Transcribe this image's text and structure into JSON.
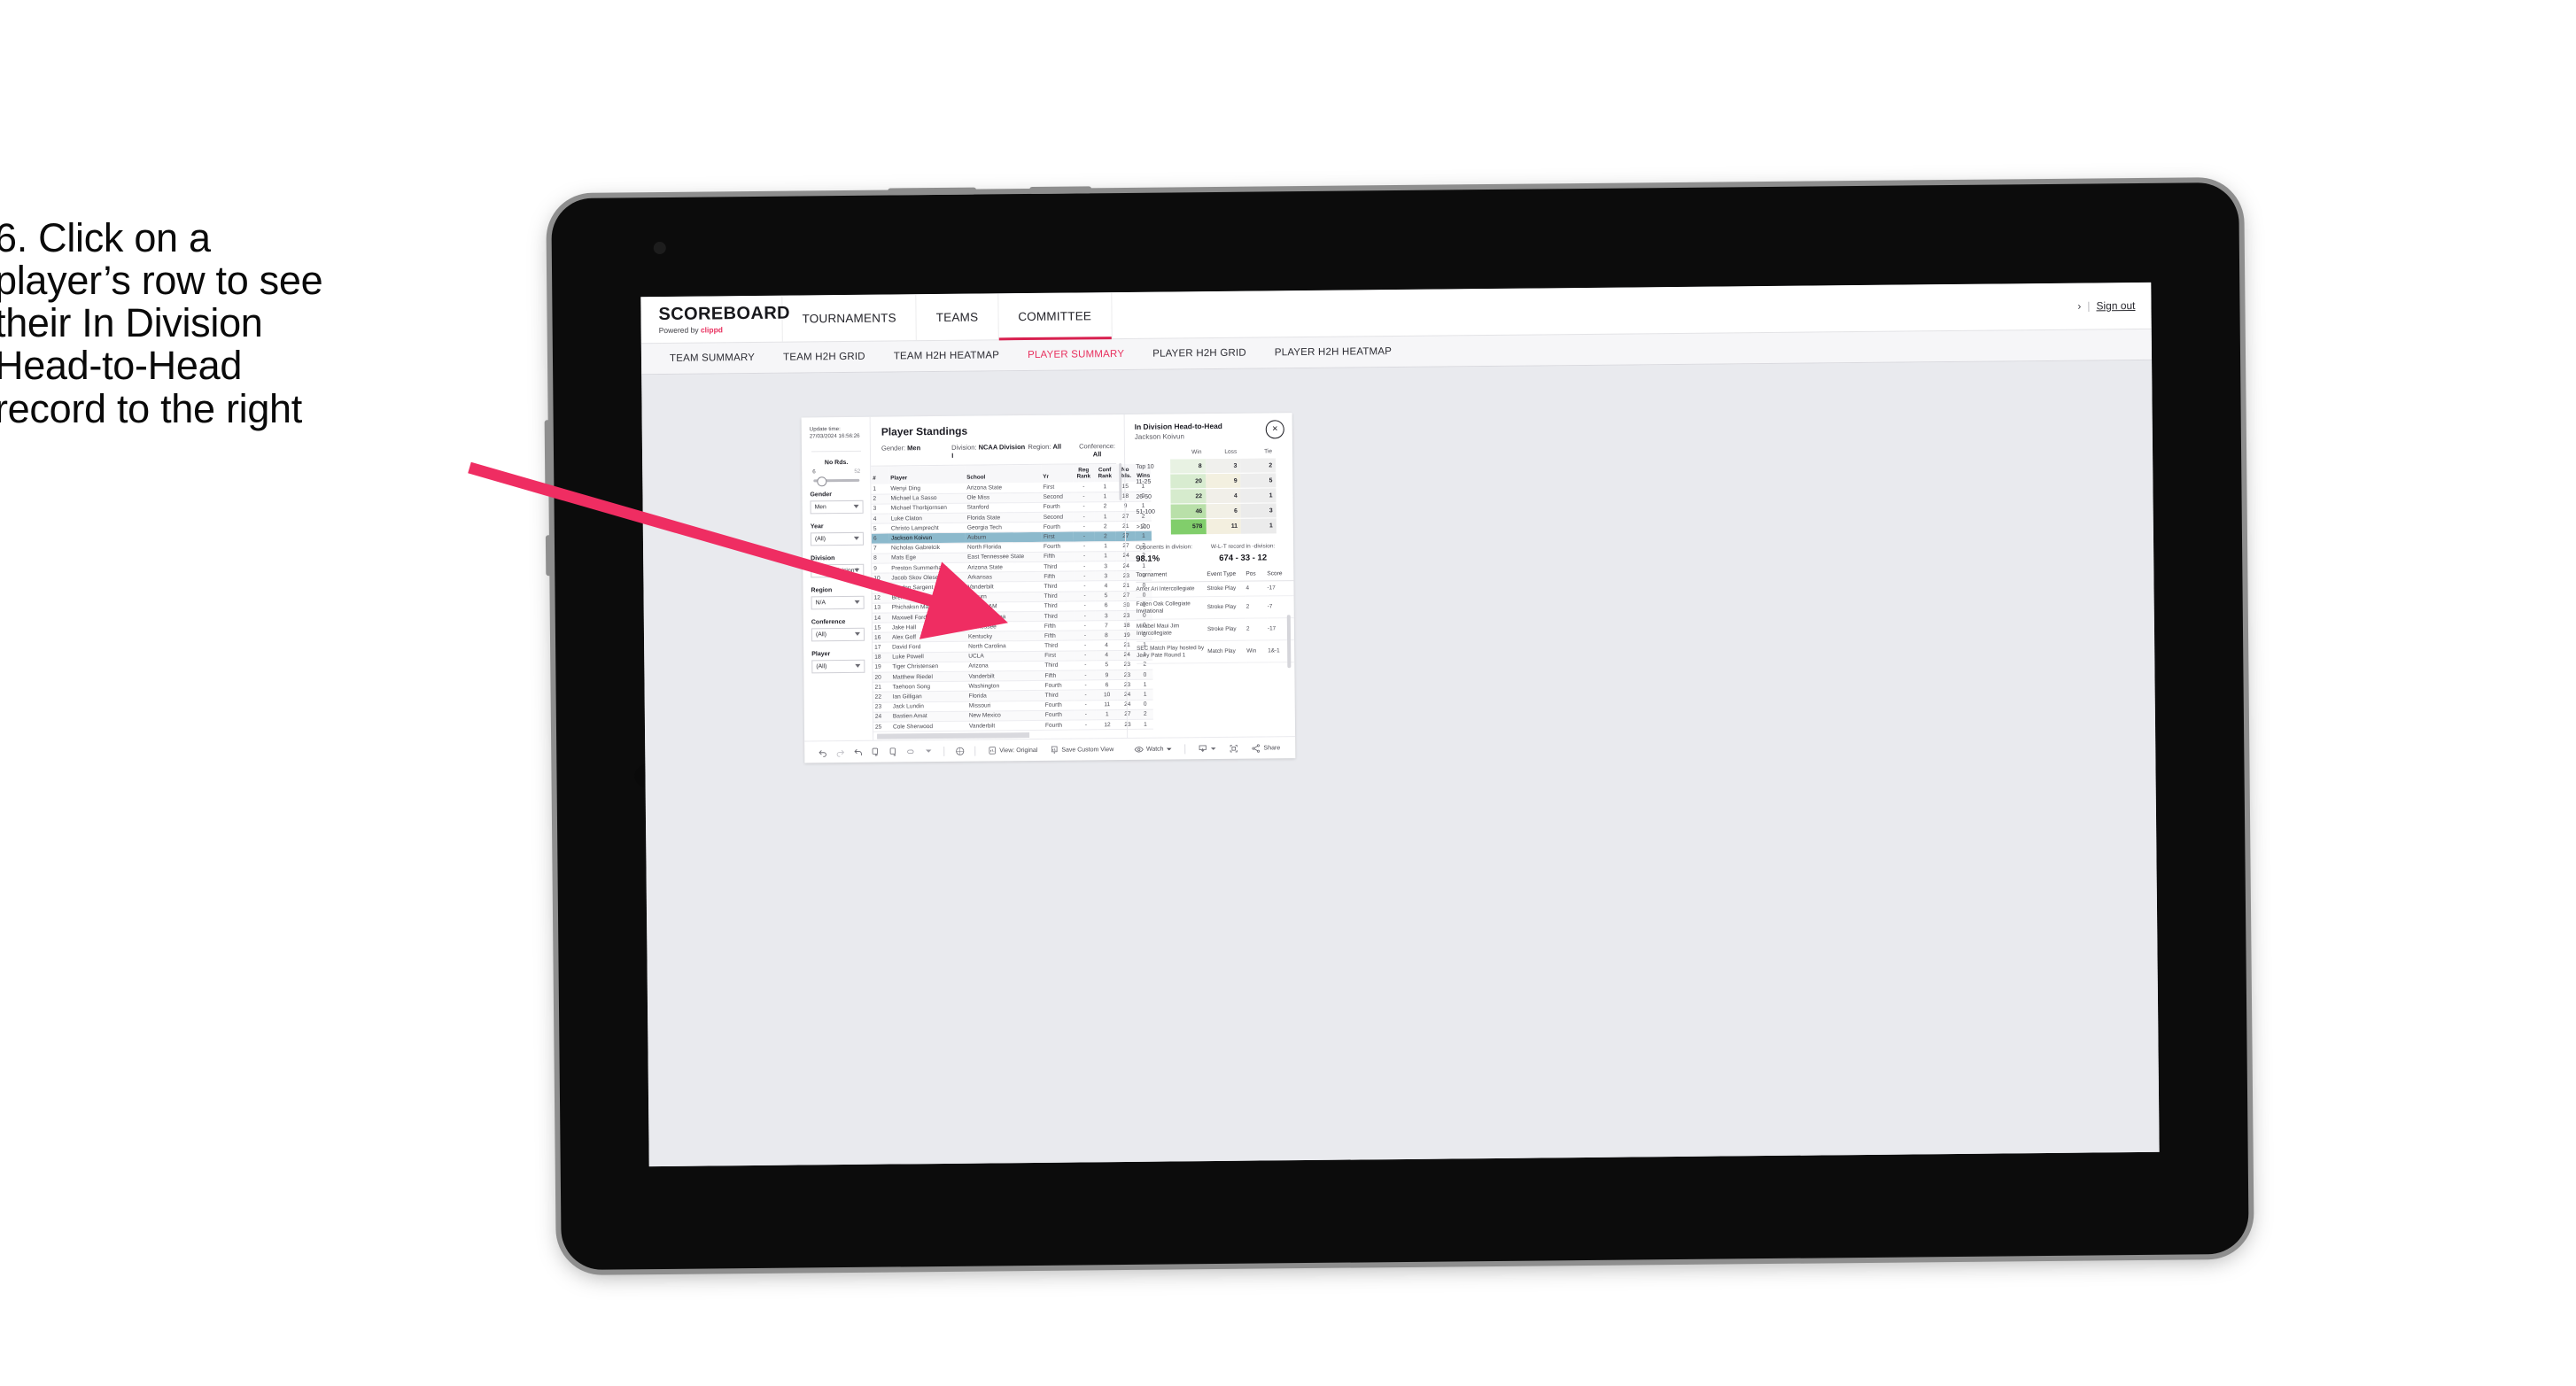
{
  "instruction": {
    "lines": [
      "6. Click on a",
      "player’s row to see",
      "their In Division",
      "Head-to-Head",
      "record to the right"
    ]
  },
  "app": {
    "brand": {
      "name": "SCOREBOARD",
      "powered_prefix": "Powered by ",
      "powered_by": "clippd"
    },
    "topnav": [
      {
        "label": "TOURNAMENTS",
        "active": false
      },
      {
        "label": "TEAMS",
        "active": false
      },
      {
        "label": "COMMITTEE",
        "active": true
      }
    ],
    "account": {
      "sep": "|",
      "sign_out": "Sign out"
    },
    "subnav": [
      {
        "label": "TEAM SUMMARY",
        "active": false
      },
      {
        "label": "TEAM H2H GRID",
        "active": false
      },
      {
        "label": "TEAM H2H HEATMAP",
        "active": false
      },
      {
        "label": "PLAYER SUMMARY",
        "active": true
      },
      {
        "label": "PLAYER H2H GRID",
        "active": false
      },
      {
        "label": "PLAYER H2H HEATMAP",
        "active": false
      }
    ]
  },
  "filters": {
    "update_time_label": "Update time:",
    "update_time_value": "27/03/2024 16:56:26",
    "slider": {
      "title": "No Rds.",
      "min": "6",
      "max": "52"
    },
    "selects": [
      {
        "label": "Gender",
        "value": "Men"
      },
      {
        "label": "Year",
        "value": "(All)"
      },
      {
        "label": "Division",
        "value": "NCAA Division I"
      },
      {
        "label": "Region",
        "value": "N/A"
      },
      {
        "label": "Conference",
        "value": "(All)"
      },
      {
        "label": "Player",
        "value": "(All)"
      }
    ]
  },
  "standings": {
    "title": "Player Standings",
    "meta": [
      {
        "label": "Gender:",
        "value": "Men"
      },
      {
        "label": "Division:",
        "value": "NCAA Division I"
      },
      {
        "label": "Region:",
        "value": "All"
      },
      {
        "label": "Conference:",
        "value": "All"
      }
    ],
    "columns": [
      "#",
      "Player",
      "School",
      "Yr",
      "Reg Rank",
      "Conf Rank",
      "No Rds.",
      "Wins"
    ],
    "rows": [
      {
        "no": "1",
        "player": "Wenyi Ding",
        "school": "Arizona State",
        "yr": "First",
        "reg": "-",
        "conf": "1",
        "rds": "15",
        "wins": "1",
        "selected": false
      },
      {
        "no": "2",
        "player": "Michael La Sasso",
        "school": "Ole Miss",
        "yr": "Second",
        "reg": "-",
        "conf": "1",
        "rds": "18",
        "wins": "0",
        "selected": false
      },
      {
        "no": "3",
        "player": "Michael Thorbjornsen",
        "school": "Stanford",
        "yr": "Fourth",
        "reg": "-",
        "conf": "2",
        "rds": "9",
        "wins": "1",
        "selected": false
      },
      {
        "no": "4",
        "player": "Luke Claton",
        "school": "Florida State",
        "yr": "Second",
        "reg": "-",
        "conf": "1",
        "rds": "27",
        "wins": "2",
        "selected": false
      },
      {
        "no": "5",
        "player": "Christo Lamprecht",
        "school": "Georgia Tech",
        "yr": "Fourth",
        "reg": "-",
        "conf": "2",
        "rds": "21",
        "wins": "2",
        "selected": false
      },
      {
        "no": "6",
        "player": "Jackson Koivun",
        "school": "Auburn",
        "yr": "First",
        "reg": "-",
        "conf": "2",
        "rds": "27",
        "wins": "1",
        "selected": true
      },
      {
        "no": "7",
        "player": "Nicholas Gabrelcik",
        "school": "North Florida",
        "yr": "Fourth",
        "reg": "-",
        "conf": "1",
        "rds": "27",
        "wins": "2",
        "selected": false
      },
      {
        "no": "8",
        "player": "Mats Ege",
        "school": "East Tennessee State",
        "yr": "Fifth",
        "reg": "-",
        "conf": "1",
        "rds": "24",
        "wins": "2",
        "selected": false
      },
      {
        "no": "9",
        "player": "Preston Summerhays",
        "school": "Arizona State",
        "yr": "Third",
        "reg": "-",
        "conf": "3",
        "rds": "24",
        "wins": "1",
        "selected": false
      },
      {
        "no": "10",
        "player": "Jacob Skov Olesen",
        "school": "Arkansas",
        "yr": "Fifth",
        "reg": "-",
        "conf": "3",
        "rds": "23",
        "wins": "0",
        "selected": false
      },
      {
        "no": "11",
        "player": "Gordon Sargent",
        "school": "Vanderbilt",
        "yr": "Third",
        "reg": "-",
        "conf": "4",
        "rds": "21",
        "wins": "0",
        "selected": false
      },
      {
        "no": "12",
        "player": "Brendan Valdes",
        "school": "Auburn",
        "yr": "Third",
        "reg": "-",
        "conf": "5",
        "rds": "27",
        "wins": "0",
        "selected": false
      },
      {
        "no": "13",
        "player": "Phichaksn Maichon",
        "school": "Texas A&M",
        "yr": "Third",
        "reg": "-",
        "conf": "6",
        "rds": "30",
        "wins": "1",
        "selected": false
      },
      {
        "no": "14",
        "player": "Maxwell Ford",
        "school": "North Carolina",
        "yr": "Third",
        "reg": "-",
        "conf": "3",
        "rds": "23",
        "wins": "0",
        "selected": false
      },
      {
        "no": "15",
        "player": "Jake Hall",
        "school": "Tennessee",
        "yr": "Fifth",
        "reg": "-",
        "conf": "7",
        "rds": "18",
        "wins": "0",
        "selected": false
      },
      {
        "no": "16",
        "player": "Alex Goff",
        "school": "Kentucky",
        "yr": "Fifth",
        "reg": "-",
        "conf": "8",
        "rds": "19",
        "wins": "0",
        "selected": false
      },
      {
        "no": "17",
        "player": "David Ford",
        "school": "North Carolina",
        "yr": "Third",
        "reg": "-",
        "conf": "4",
        "rds": "21",
        "wins": "1",
        "selected": false
      },
      {
        "no": "18",
        "player": "Luke Powell",
        "school": "UCLA",
        "yr": "First",
        "reg": "-",
        "conf": "4",
        "rds": "24",
        "wins": "1",
        "selected": false
      },
      {
        "no": "19",
        "player": "Tiger Christensen",
        "school": "Arizona",
        "yr": "Third",
        "reg": "-",
        "conf": "5",
        "rds": "23",
        "wins": "2",
        "selected": false
      },
      {
        "no": "20",
        "player": "Matthew Riedel",
        "school": "Vanderbilt",
        "yr": "Fifth",
        "reg": "-",
        "conf": "9",
        "rds": "23",
        "wins": "0",
        "selected": false
      },
      {
        "no": "21",
        "player": "Taehoon Song",
        "school": "Washington",
        "yr": "Fourth",
        "reg": "-",
        "conf": "6",
        "rds": "23",
        "wins": "1",
        "selected": false
      },
      {
        "no": "22",
        "player": "Ian Gilligan",
        "school": "Florida",
        "yr": "Third",
        "reg": "-",
        "conf": "10",
        "rds": "24",
        "wins": "1",
        "selected": false
      },
      {
        "no": "23",
        "player": "Jack Lundin",
        "school": "Missouri",
        "yr": "Fourth",
        "reg": "-",
        "conf": "11",
        "rds": "24",
        "wins": "0",
        "selected": false
      },
      {
        "no": "24",
        "player": "Bastien Amat",
        "school": "New Mexico",
        "yr": "Fourth",
        "reg": "-",
        "conf": "1",
        "rds": "27",
        "wins": "2",
        "selected": false
      },
      {
        "no": "25",
        "player": "Cole Sherwood",
        "school": "Vanderbilt",
        "yr": "Fourth",
        "reg": "-",
        "conf": "12",
        "rds": "23",
        "wins": "1",
        "selected": false
      }
    ]
  },
  "h2h": {
    "title": "In Division Head-to-Head",
    "player": "Jackson Koivun",
    "close_label": "×",
    "columns": [
      "",
      "Win",
      "Loss",
      "Tie"
    ],
    "rows": [
      {
        "band": "Top 10",
        "win": "8",
        "loss": "3",
        "tie": "2",
        "win_color": "#e8f2e3",
        "loss_color": "#f0f0ed",
        "tie_color": "#efefef"
      },
      {
        "band": "11-25",
        "win": "20",
        "loss": "9",
        "tie": "5",
        "win_color": "#d8ecd0",
        "loss_color": "#f3f0e0",
        "tie_color": "#ededed"
      },
      {
        "band": "26-50",
        "win": "22",
        "loss": "4",
        "tie": "1",
        "win_color": "#d6ebcd",
        "loss_color": "#f1efe9",
        "tie_color": "#ededed"
      },
      {
        "band": "51-100",
        "win": "46",
        "loss": "6",
        "tie": "3",
        "win_color": "#b9e0a9",
        "loss_color": "#f2f0e6",
        "tie_color": "#ebebeb"
      },
      {
        "band": ">100",
        "win": "578",
        "loss": "11",
        "tie": "1",
        "win_color": "#81ce6b",
        "loss_color": "#f3efdf",
        "tie_color": "#ebebeb"
      }
    ],
    "summary": [
      {
        "label": "Opponents in division:",
        "value": "98.1%"
      },
      {
        "label": "W-L-T record in -division:",
        "value": "674 - 33 - 12"
      }
    ],
    "tournament_columns": [
      "Tournament",
      "Event Type",
      "Pos",
      "Score"
    ],
    "tournaments": [
      {
        "name": "Amer Ari Intercollegiate",
        "type": "Stroke Play",
        "pos": "4",
        "score": "-17"
      },
      {
        "name": "Fallen Oak Collegiate Invitational",
        "type": "Stroke Play",
        "pos": "2",
        "score": "-7"
      },
      {
        "name": "Mirabel Maui Jim Intercollegiate",
        "type": "Stroke Play",
        "pos": "2",
        "score": "-17"
      },
      {
        "name": "SEC Match Play hosted by Jerry Pate Round 1",
        "type": "Match Play",
        "pos": "Win",
        "score": "1&-1"
      }
    ]
  },
  "toolbar": {
    "icons": [
      "undo-icon",
      "redo-icon",
      "revert-icon",
      "refresh-icon",
      "pause-icon",
      "highlight-icon",
      "dashboard-icon"
    ],
    "view_label": "View: Original",
    "save_label": "Save Custom View",
    "watch_label": "Watch",
    "share_label": "Share"
  },
  "colors": {
    "accent": "#e8315f",
    "tab_underline": "#d8204f",
    "selection": "#8cb9cc",
    "arrow": "#ef2d62"
  }
}
